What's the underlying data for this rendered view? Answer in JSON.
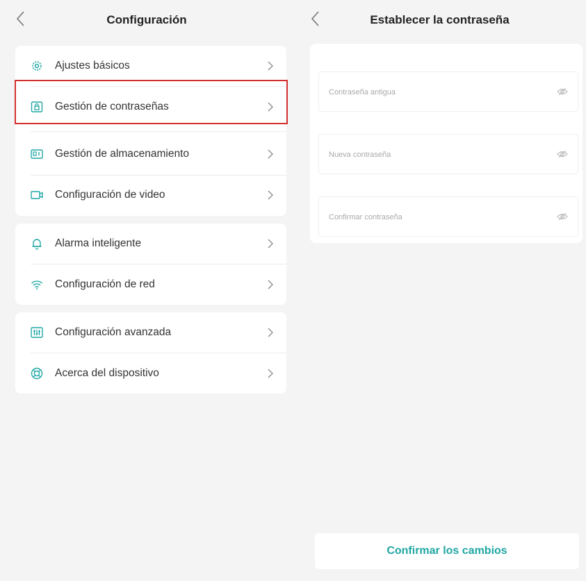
{
  "colors": {
    "accent": "#1fa7a3",
    "highlight": "#d32f2f",
    "background": "#f4f4f4"
  },
  "config": {
    "title": "Configuración",
    "groups": [
      {
        "items": [
          {
            "label": "Ajustes básicos",
            "icon": "gear-icon"
          },
          {
            "label": "Gestión de contraseñas",
            "icon": "lock-icon"
          },
          {
            "label": "Gestión de almacenamiento",
            "icon": "storage-icon"
          },
          {
            "label": "Configuración de video",
            "icon": "video-icon"
          }
        ]
      },
      {
        "items": [
          {
            "label": "Alarma inteligente",
            "icon": "bell-icon"
          },
          {
            "label": "Configuración de red",
            "icon": "wifi-icon"
          }
        ]
      },
      {
        "items": [
          {
            "label": "Configuración avanzada",
            "icon": "sliders-icon"
          },
          {
            "label": "Acerca del dispositivo",
            "icon": "info-icon"
          }
        ]
      }
    ]
  },
  "password": {
    "title": "Establecer la contraseña",
    "fields": [
      {
        "placeholder": "Contraseña antigua",
        "value": ""
      },
      {
        "placeholder": "Nueva contraseña",
        "value": ""
      },
      {
        "placeholder": "Confirmar contraseña",
        "value": ""
      }
    ],
    "confirm_label": "Confirmar los cambios"
  }
}
